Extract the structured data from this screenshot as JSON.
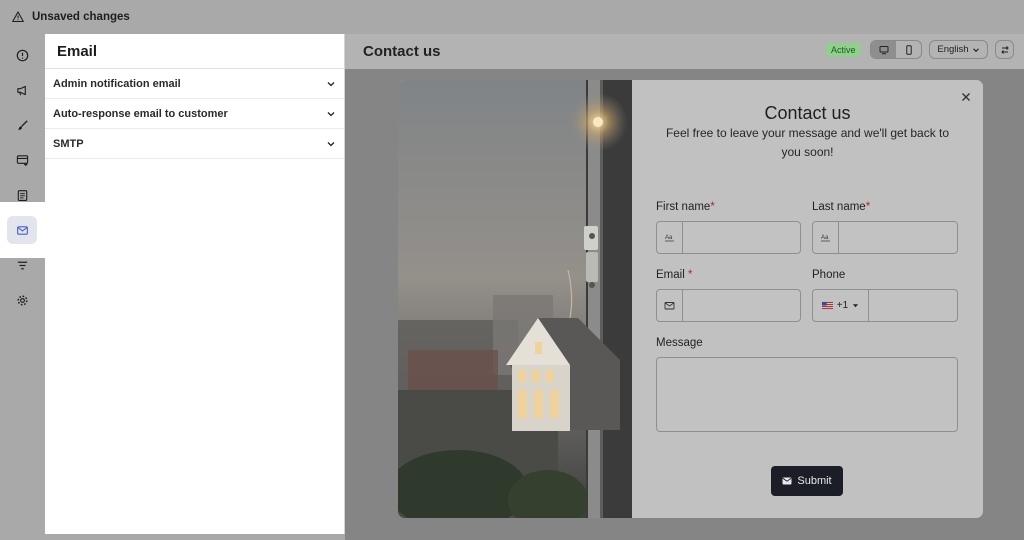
{
  "topbar": {
    "title": "Unsaved changes"
  },
  "rail": {
    "items": [
      {
        "icon": "info-icon"
      },
      {
        "icon": "megaphone-icon"
      },
      {
        "icon": "brush-icon"
      },
      {
        "icon": "layout-add-icon"
      },
      {
        "icon": "document-icon"
      },
      {
        "icon": "envelope-icon",
        "active": true
      },
      {
        "icon": "filter-icon"
      },
      {
        "icon": "gear-icon"
      }
    ]
  },
  "panel": {
    "title": "Email",
    "sections": [
      {
        "label": "Admin notification email"
      },
      {
        "label": "Auto-response email to customer"
      },
      {
        "label": "SMTP"
      }
    ]
  },
  "preview": {
    "title": "Contact us",
    "status": "Active",
    "language": "English"
  },
  "form": {
    "title": "Contact us",
    "subtitle": "Feel free to leave your message and we'll get back to you soon!",
    "first_name_label": "First name",
    "last_name_label": "Last name",
    "email_label": "Email ",
    "phone_label": "Phone",
    "phone_code": "+1",
    "message_label": "Message",
    "required_mark": "*",
    "submit_label": "Submit"
  },
  "colors": {
    "active_badge": "#8fd08d",
    "submit_bg": "#1b1e26",
    "required": "#b3261e",
    "overlay": "#858585"
  }
}
